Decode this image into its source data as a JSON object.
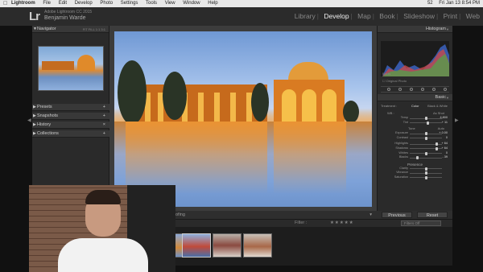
{
  "menubar": {
    "apple": "",
    "items": [
      "Lightroom",
      "File",
      "Edit",
      "Develop",
      "Photo",
      "Settings",
      "Tools",
      "View",
      "Window",
      "Help"
    ],
    "status": [
      "52",
      "Fri Jan 13 8:54 PM"
    ]
  },
  "identity": {
    "logo": "Lr",
    "subtitle": "Adobe Lightroom CC 2015",
    "name": "Benjamin Warde"
  },
  "modules": [
    "Library",
    "Develop",
    "Map",
    "Book",
    "Slideshow",
    "Print",
    "Web"
  ],
  "modules_active": "Develop",
  "left_panel": {
    "navigator": "Navigator",
    "fit_labels": "FIT FILL 1:1 3:1",
    "sections": [
      "Presets",
      "Snapshots",
      "History",
      "Collections"
    ]
  },
  "toolbar": {
    "label": "ofing"
  },
  "right_panel": {
    "histogram": "Histogram",
    "histo_meta": "Blacks",
    "original_photo": "Original Photo",
    "basic": "Basic",
    "treatment": "Treatment :",
    "color": "Color",
    "bw": "Black & White",
    "wb_label": "WB :",
    "wb_value": "As Shot",
    "temp_label": "Temp",
    "temp_value": "4,800",
    "tint_label": "Tint",
    "tint_value": "+ 11",
    "tone": "Tone",
    "auto": "Auto",
    "exposure_label": "Exposure",
    "exposure_value": "+ 0.00",
    "contrast_label": "Contrast",
    "contrast_value": "0",
    "highlights_label": "Highlights",
    "highlights_value": "+ 64",
    "shadows_label": "Shadows",
    "shadows_value": "+ 64",
    "whites_label": "Whites",
    "whites_value": "0",
    "blacks_label": "Blacks",
    "blacks_value": "- 39",
    "presence": "Presence",
    "clarity_label": "Clarity",
    "vibrance_label": "Vibrance",
    "saturation_label": "Saturation",
    "previous": "Previous",
    "reset": "Reset"
  },
  "filmbar": {
    "filter": "Filter :",
    "stars": "★★★★★",
    "filter_off": "Filters Off"
  },
  "colors": {
    "panel": "#2a2a2a",
    "menubar": "#e8e8e8",
    "accent_orange": "#e08a2a",
    "sky_blue": "#8fb0dd"
  }
}
